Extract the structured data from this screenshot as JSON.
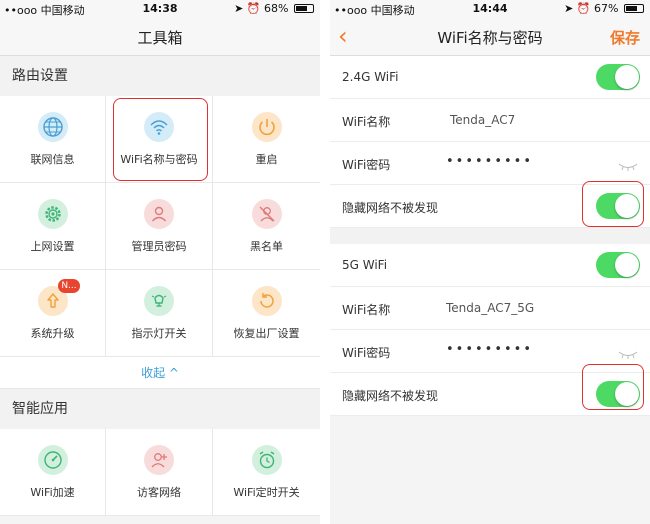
{
  "left": {
    "status": {
      "carrier": "••ooo 中国移动",
      "time": "14:38",
      "battery": "68%",
      "battery_level": 0.68
    },
    "title": "工具箱",
    "section1": "路由设置",
    "tools": [
      {
        "label": "联网信息",
        "icon": "globe-icon"
      },
      {
        "label": "WiFi名称与密码",
        "icon": "wifi-icon"
      },
      {
        "label": "重启",
        "icon": "power-icon"
      },
      {
        "label": "上网设置",
        "icon": "gear-icon"
      },
      {
        "label": "管理员密码",
        "icon": "user-icon"
      },
      {
        "label": "黑名单",
        "icon": "blocked-user-icon"
      },
      {
        "label": "系统升级",
        "icon": "upgrade-icon"
      },
      {
        "label": "指示灯开关",
        "icon": "lamp-icon"
      },
      {
        "label": "恢复出厂设置",
        "icon": "reset-icon"
      }
    ],
    "upgrade_badge": "N...",
    "collapse": "收起 ^",
    "section2": "智能应用",
    "apps": [
      {
        "label": "WiFi加速",
        "icon": "speedometer-icon"
      },
      {
        "label": "访客网络",
        "icon": "guest-icon"
      },
      {
        "label": "WiFi定时开关",
        "icon": "alarm-clock-icon"
      }
    ]
  },
  "right": {
    "status": {
      "carrier": "••ooo 中国移动",
      "time": "14:44",
      "battery": "67%",
      "battery_level": 0.67
    },
    "title": "WiFi名称与密码",
    "save": "保存",
    "band24": {
      "label": "2.4G WiFi",
      "enabled": true
    },
    "ssid24": {
      "key": "WiFi名称",
      "value": "Tenda_AC7"
    },
    "pwd24": {
      "key": "WiFi密码",
      "value": "•••••••••"
    },
    "hide24": {
      "key": "隐藏网络不被发现",
      "enabled": true
    },
    "band5": {
      "label": "5G WiFi",
      "enabled": true
    },
    "ssid5": {
      "key": "WiFi名称",
      "value": "Tenda_AC7_5G"
    },
    "pwd5": {
      "key": "WiFi密码",
      "value": "•••••••••"
    },
    "hide5": {
      "key": "隐藏网络不被发现",
      "enabled": true
    }
  },
  "colors": {
    "accent": "#f07a2c",
    "toggle_on": "#4cd964",
    "highlight": "#e03030",
    "link": "#3aa0d8"
  }
}
